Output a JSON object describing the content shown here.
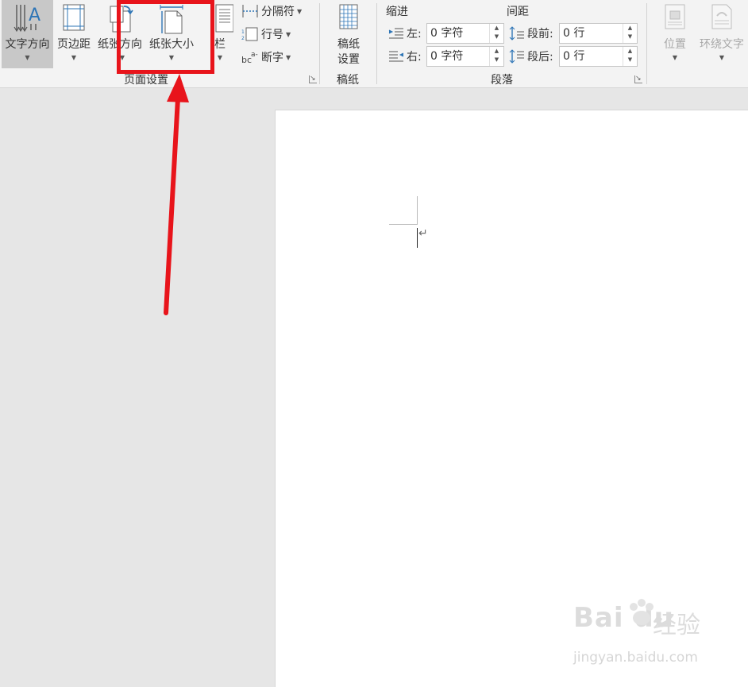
{
  "ribbon": {
    "page_setup": {
      "text_direction": "文字方向",
      "margins": "页边距",
      "orientation": "纸张方向",
      "size": "纸张大小",
      "columns": "栏",
      "breaks": "分隔符",
      "line_numbers": "行号",
      "hyphenation": "断字",
      "group_label": "页面设置"
    },
    "manuscript": {
      "button_line1": "稿纸",
      "button_line2": "设置",
      "group_label": "稿纸"
    },
    "paragraph": {
      "indent_label": "缩进",
      "spacing_label": "间距",
      "left_label": "左:",
      "left_value": "0 字符",
      "right_label": "右:",
      "right_value": "0 字符",
      "before_label": "段前:",
      "before_value": "0 行",
      "after_label": "段后:",
      "after_value": "0 行",
      "group_label": "段落"
    },
    "arrange": {
      "position": "位置",
      "wrap_text": "环绕文字"
    }
  },
  "document": {
    "paragraph_mark": "↵"
  },
  "annotation": {
    "highlight_color": "#e8141b",
    "arrow_color": "#e8141b"
  },
  "watermark": {
    "logo": "Bai du",
    "brand": "经验",
    "url": "jingyan.baidu.com"
  },
  "colors": {
    "ribbon_bg": "#f3f3f3",
    "workspace_bg": "#e6e6e6",
    "selected_button_bg": "#c8c8c8",
    "icon_blue": "#2e75b6"
  }
}
